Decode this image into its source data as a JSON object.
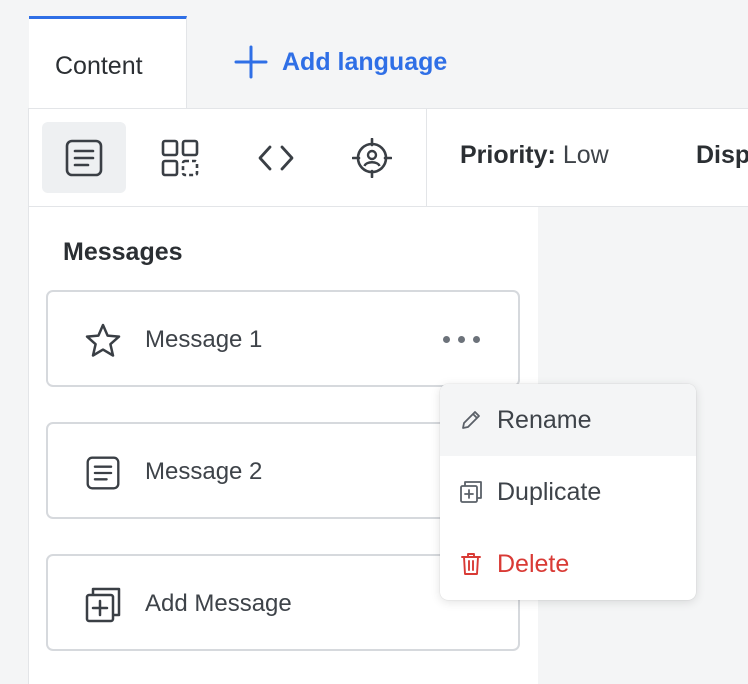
{
  "tabs": {
    "active_label": "Content",
    "add_language_label": "Add language"
  },
  "toolbar": {
    "tools": [
      {
        "icon": "message-content-icon",
        "active": true
      },
      {
        "icon": "qr-code-icon",
        "active": false
      },
      {
        "icon": "code-icon",
        "active": false
      },
      {
        "icon": "target-user-icon",
        "active": false
      }
    ],
    "priority_label": "Priority:",
    "priority_value": "Low",
    "display_label_partial": "Disp"
  },
  "sidebar": {
    "title": "Messages",
    "items": [
      {
        "label": "Message 1",
        "icon": "star-icon"
      },
      {
        "label": "Message 2",
        "icon": "message-content-icon"
      },
      {
        "label": "Add Message",
        "icon": "add-copy-icon"
      }
    ]
  },
  "context_menu": {
    "items": [
      {
        "label": "Rename",
        "icon": "pencil-icon",
        "highlighted": true
      },
      {
        "label": "Duplicate",
        "icon": "duplicate-icon"
      },
      {
        "label": "Delete",
        "icon": "trash-icon",
        "danger": true
      }
    ]
  },
  "colors": {
    "accent": "#2f6fe6",
    "danger": "#d93a35",
    "text": "#2b2f33",
    "border": "#d6d9dd",
    "background": "#f4f5f6"
  }
}
